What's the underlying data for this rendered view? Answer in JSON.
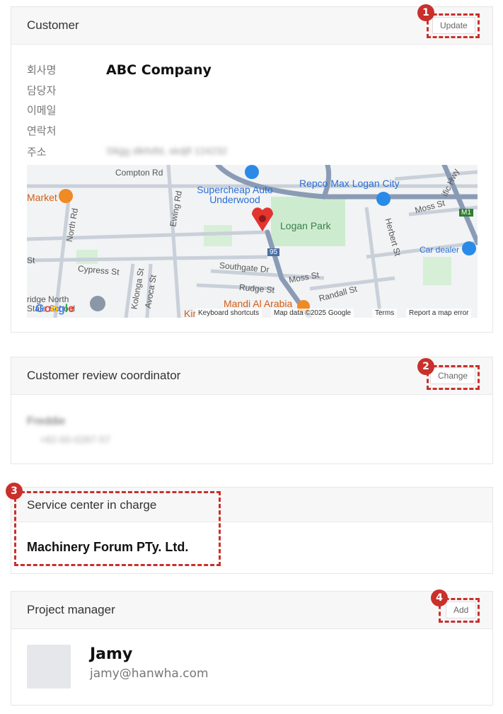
{
  "customer": {
    "title": "Customer",
    "update_label": "Update",
    "marker": "1",
    "labels": {
      "company": "회사명",
      "manager": "담당자",
      "email": "이메일",
      "contact": "연락처",
      "address": "주소"
    },
    "company_name": "ABC Company",
    "address_value": "Slkjjg dlkfslfd, skdjfl 124232"
  },
  "map": {
    "labels": {
      "compton": "Compton Rd",
      "supercheap": "Supercheap Auto Underwood",
      "repco": "Repco Max Logan City",
      "market": "Market",
      "north": "North Rd",
      "ewing": "Ewing Rd",
      "logan_park": "Logan Park",
      "moss_st": "Moss St",
      "moss_st2": "Moss St",
      "herbert": "Herbert St",
      "car_dealer": "Car dealer",
      "st": "St",
      "cypress": "Cypress St",
      "kolonga": "Kolonga St",
      "avoca": "Avoca St",
      "southgate": "Southgate Dr",
      "rudge": "Rudge St",
      "randall": "Randall St",
      "mandi": "Mandi Al Arabia",
      "school": "ridge North State School",
      "hwy": "ific Hwy",
      "m1": "M1",
      "r95": "95",
      "kir": "Kir"
    },
    "google": "Google",
    "footer": {
      "shortcuts": "Keyboard shortcuts",
      "mapdata": "Map data ©2025 Google",
      "terms": "Terms",
      "report": "Report a map error"
    }
  },
  "coordinator": {
    "title": "Customer review coordinator",
    "change_label": "Change",
    "marker": "2",
    "name": "Freddie",
    "phone": "+82-00-0287-57"
  },
  "service_center": {
    "title": "Service center in charge",
    "marker": "3",
    "name": "Machinery Forum PTy. Ltd."
  },
  "project_manager": {
    "title": "Project manager",
    "add_label": "Add",
    "marker": "4",
    "name": "Jamy",
    "email": "jamy@hanwha.com"
  }
}
